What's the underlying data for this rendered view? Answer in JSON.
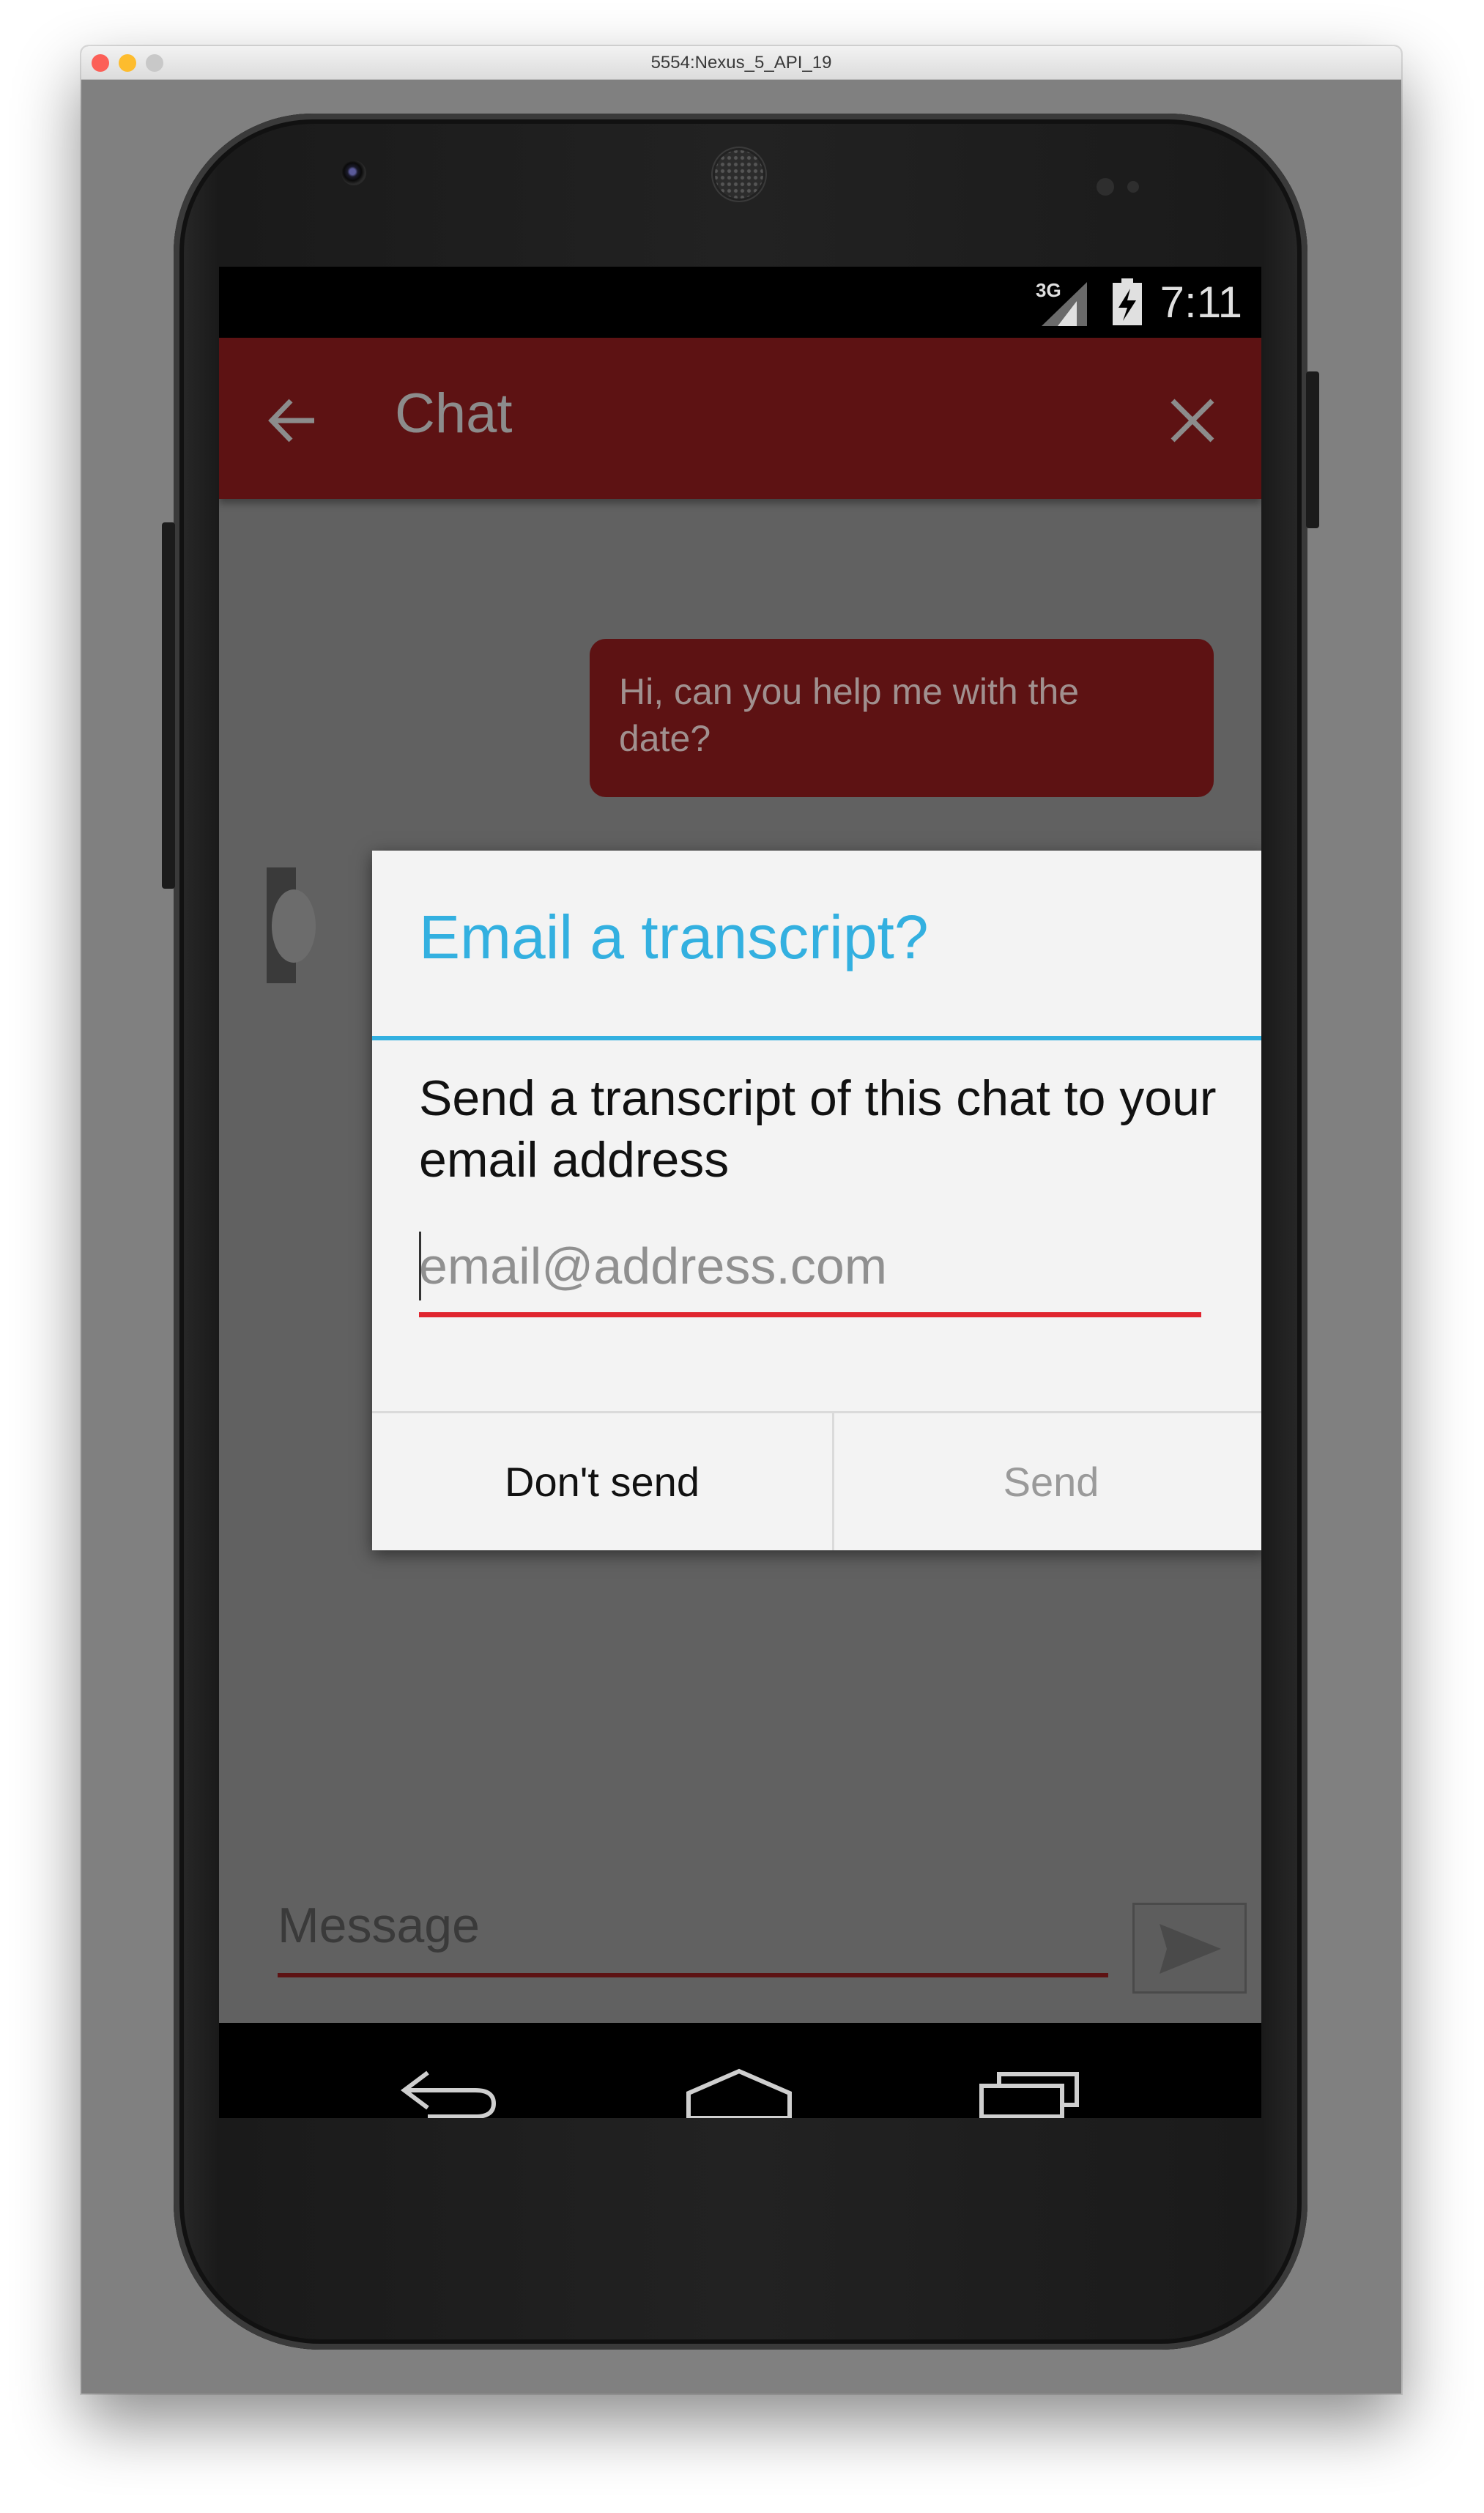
{
  "window": {
    "title": "5554:Nexus_5_API_19",
    "traffic_colors": [
      "#fc5f57",
      "#fdbc2e",
      "#c8c8c8"
    ]
  },
  "status_bar": {
    "network": "3G",
    "time": "7:11"
  },
  "app_bar": {
    "title": "Chat",
    "back_icon": "back-arrow-icon",
    "close_icon": "close-icon",
    "color": "#5d1213"
  },
  "conversation": {
    "messages": [
      {
        "text": "Hi, can you help me with the date?",
        "sender": "user"
      }
    ]
  },
  "composer": {
    "placeholder": "Message",
    "send_icon": "send-icon"
  },
  "dialog": {
    "title": "Email a transcript?",
    "message": "Send a transcript of this chat to your email address",
    "email_placeholder": "email@address.com",
    "email_value": "",
    "buttons": {
      "negative": "Don't send",
      "positive": "Send"
    },
    "accent_color": "#33b0e0",
    "error_color": "#e0252f"
  },
  "nav_bar": {
    "icons": [
      "back-icon",
      "home-icon",
      "recents-icon"
    ]
  }
}
